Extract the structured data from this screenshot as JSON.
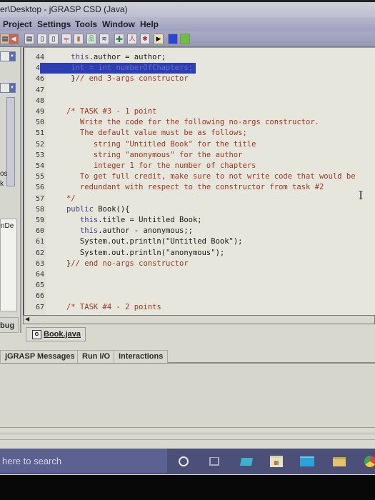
{
  "window": {
    "title": "er\\Desktop - jGRASP CSD (Java)"
  },
  "menu": {
    "items": [
      "Project",
      "Settings",
      "Tools",
      "Window",
      "Help"
    ]
  },
  "toolbar": {
    "icons": [
      "back-icon",
      "new-file-icon",
      "file-icon",
      "file-alt-icon",
      "pin-icon",
      "bar-chart-icon",
      "hierarchy-icon",
      "book-icon",
      "add-icon",
      "run-icon",
      "debug-bug-icon",
      "step-icon",
      "blue-square-icon",
      "green-square-icon"
    ]
  },
  "left_panel": {
    "text_os": "os",
    "text_k": "k",
    "text_nde": "nDe",
    "text_bug": "bug"
  },
  "editor": {
    "lines": [
      {
        "n": "44",
        "segments": [
          {
            "t": "    ",
            "c": "plain"
          },
          {
            "t": "this",
            "c": "kw"
          },
          {
            "t": ".author = author;",
            "c": "plain"
          }
        ]
      },
      {
        "n": "45",
        "selected": true,
        "segments": [
          {
            "t": "    int = int numberOfChapters;",
            "c": "sel-text"
          }
        ]
      },
      {
        "n": "46",
        "segments": [
          {
            "t": "    }",
            "c": "plain"
          },
          {
            "t": "// end 3-args constructor",
            "c": "cmt"
          }
        ]
      },
      {
        "n": "47",
        "segments": []
      },
      {
        "n": "48",
        "segments": []
      },
      {
        "n": "49",
        "segments": [
          {
            "t": "   /* TASK #3 - 1 point",
            "c": "cmt"
          }
        ]
      },
      {
        "n": "50",
        "segments": [
          {
            "t": "      Write the code for the following no-args constructor.",
            "c": "cmt"
          }
        ]
      },
      {
        "n": "51",
        "segments": [
          {
            "t": "      The default value must be as follows;",
            "c": "cmt"
          }
        ]
      },
      {
        "n": "52",
        "segments": [
          {
            "t": "         string \"Untitled Book\" for the title",
            "c": "cmt"
          }
        ]
      },
      {
        "n": "53",
        "segments": [
          {
            "t": "         string \"anonymous\" for the author",
            "c": "cmt"
          }
        ]
      },
      {
        "n": "54",
        "segments": [
          {
            "t": "         integer 1 for the number of chapters",
            "c": "cmt"
          }
        ]
      },
      {
        "n": "55",
        "segments": [
          {
            "t": "      To get full credit, make sure to not write code that would be",
            "c": "cmt"
          }
        ]
      },
      {
        "n": "56",
        "segments": [
          {
            "t": "      redundant with respect to the constructor from task #2",
            "c": "cmt"
          }
        ]
      },
      {
        "n": "57",
        "segments": [
          {
            "t": "   */",
            "c": "cmt"
          }
        ]
      },
      {
        "n": "58",
        "segments": [
          {
            "t": "   ",
            "c": "plain"
          },
          {
            "t": "public",
            "c": "kw"
          },
          {
            "t": " Book(){",
            "c": "plain"
          }
        ]
      },
      {
        "n": "59",
        "segments": [
          {
            "t": "      ",
            "c": "plain"
          },
          {
            "t": "this",
            "c": "kw"
          },
          {
            "t": ".title = Untitled Book;",
            "c": "plain"
          }
        ]
      },
      {
        "n": "60",
        "segments": [
          {
            "t": "      ",
            "c": "plain"
          },
          {
            "t": "this",
            "c": "kw"
          },
          {
            "t": ".author - anonymous;;",
            "c": "plain"
          }
        ]
      },
      {
        "n": "61",
        "segments": [
          {
            "t": "      System.out.println(\"Untitled Book\");",
            "c": "plain"
          }
        ]
      },
      {
        "n": "62",
        "segments": [
          {
            "t": "      System.out.println(\"anonymous\");",
            "c": "plain"
          }
        ]
      },
      {
        "n": "63",
        "segments": [
          {
            "t": "   }",
            "c": "plain"
          },
          {
            "t": "// end no-args constructor",
            "c": "cmt"
          }
        ]
      },
      {
        "n": "64",
        "segments": []
      },
      {
        "n": "65",
        "segments": []
      },
      {
        "n": "66",
        "segments": []
      },
      {
        "n": "67",
        "segments": [
          {
            "t": "   /* TASK #4 - 2 points",
            "c": "cmt"
          }
        ]
      }
    ],
    "cursor_glyph": "I"
  },
  "file_tab": {
    "icon_label": "G",
    "label": "Book.java"
  },
  "bottom_tabs": [
    "jGRASP Messages",
    "Run I/O",
    "Interactions"
  ],
  "taskbar": {
    "search_placeholder": "here to search",
    "icons": [
      "cortana-icon",
      "task-view-icon",
      "monitor-icon",
      "store-icon",
      "mail-icon",
      "file-explorer-icon",
      "chrome-icon"
    ]
  }
}
